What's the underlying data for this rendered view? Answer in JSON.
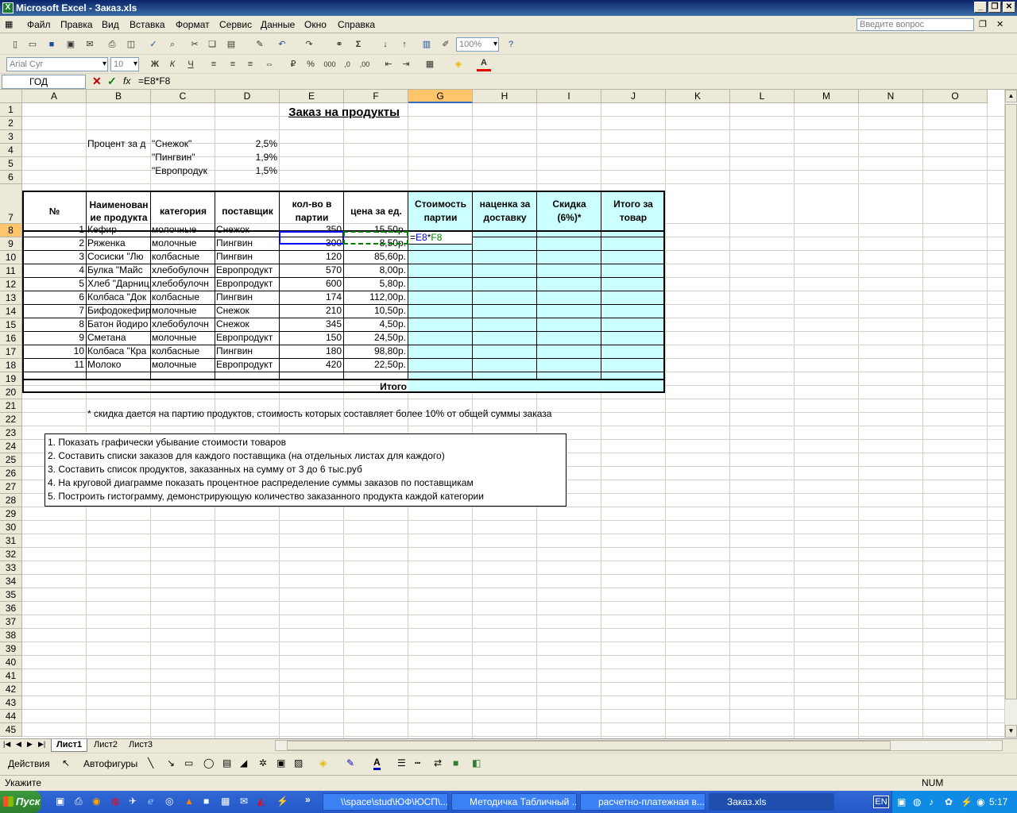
{
  "window": {
    "title": "Microsoft Excel - Заказ.xls"
  },
  "menu": {
    "items": [
      "Файл",
      "Правка",
      "Вид",
      "Вставка",
      "Формат",
      "Сервис",
      "Данные",
      "Окно",
      "Справка"
    ],
    "ask_placeholder": "Введите вопрос"
  },
  "toolbar": {
    "zoom": "100%",
    "font": "Arial Cyr",
    "size": "10"
  },
  "formula": {
    "namebox": "ГОД",
    "content": "=E8*F8"
  },
  "columns": [
    "A",
    "B",
    "C",
    "D",
    "E",
    "F",
    "G",
    "H",
    "I",
    "J",
    "K",
    "L",
    "M",
    "N",
    "O"
  ],
  "rows": [
    "1",
    "2",
    "3",
    "4",
    "5",
    "6",
    "7",
    "8",
    "9",
    "10",
    "11",
    "12",
    "13",
    "14",
    "15",
    "16",
    "17",
    "18",
    "19",
    "20",
    "21",
    "22",
    "23",
    "24",
    "25",
    "26",
    "27",
    "28",
    "29",
    "30",
    "31",
    "32",
    "33",
    "34",
    "35",
    "36",
    "37",
    "38",
    "39",
    "40",
    "41",
    "42",
    "43",
    "44",
    "45"
  ],
  "sheet": {
    "title": "Заказ на продукты",
    "pct_label": "Процент за д",
    "suppliers_pct": [
      {
        "name": "\"Снежок\"",
        "pct": "2,5%"
      },
      {
        "name": "\"Пингвин\"",
        "pct": "1,9%"
      },
      {
        "name": "\"Европродук",
        "pct": "1,5%"
      }
    ],
    "headers": {
      "num": "№",
      "name": "Наименование продукта",
      "cat": "категория",
      "sup": "поставщик",
      "qty": "кол-во в партии",
      "price": "цена за ед.",
      "cost": "Стоимость партии",
      "markup": "наценка за доставку",
      "disc": "Скидка (6%)*",
      "total": "Итого за товар"
    },
    "items": [
      {
        "n": "1",
        "name": "Кефир",
        "cat": "молочные",
        "sup": "Снежок",
        "qty": "350",
        "price": "15,50р."
      },
      {
        "n": "2",
        "name": "Ряженка",
        "cat": "молочные",
        "sup": "Пингвин",
        "qty": "300",
        "price": "8,50р."
      },
      {
        "n": "3",
        "name": "Сосиски \"Лю",
        "cat": "колбасные",
        "sup": "Пингвин",
        "qty": "120",
        "price": "85,60р."
      },
      {
        "n": "4",
        "name": "Булка \"Майс",
        "cat": "хлебобулочн",
        "sup": "Европродукт",
        "qty": "570",
        "price": "8,00р."
      },
      {
        "n": "5",
        "name": "Хлеб \"Дарниц",
        "cat": "хлебобулочн",
        "sup": "Европродукт",
        "qty": "600",
        "price": "5,80р."
      },
      {
        "n": "6",
        "name": "Колбаса \"Док",
        "cat": "колбасные",
        "sup": "Пингвин",
        "qty": "174",
        "price": "112,00р."
      },
      {
        "n": "7",
        "name": "Бифодокефир",
        "cat": "молочные",
        "sup": "Снежок",
        "qty": "210",
        "price": "10,50р."
      },
      {
        "n": "8",
        "name": "Батон йодиро",
        "cat": "хлебобулочн",
        "sup": "Снежок",
        "qty": "345",
        "price": "4,50р."
      },
      {
        "n": "9",
        "name": "Сметана",
        "cat": "молочные",
        "sup": "Европродукт",
        "qty": "150",
        "price": "24,50р."
      },
      {
        "n": "10",
        "name": "Колбаса \"Кра",
        "cat": "колбасные",
        "sup": "Пингвин",
        "qty": "180",
        "price": "98,80р."
      },
      {
        "n": "11",
        "name": "Молоко",
        "cat": "молочные",
        "sup": "Европродукт",
        "qty": "420",
        "price": "22,50р."
      }
    ],
    "edit_cell": "=E8*F8",
    "total_label": "Итого",
    "footnote": "* скидка дается на партию продуктов, стоимость которых составляет более 10% от общей суммы заказа",
    "tasks": [
      "1. Показать графически убывание стоимости товаров",
      "2. Составить списки заказов для каждого поставщика (на отдельных листах для каждого)",
      "3. Составить список продуктов, заказанных на сумму от 3 до 6 тыс.руб",
      "4. На круговой диаграмме показать процентное распределение суммы заказов по поставщикам",
      "5. Построить гистограмму, демонстрирующую количество заказанного продукта каждой категории"
    ]
  },
  "tabs": [
    "Лист1",
    "Лист2",
    "Лист3"
  ],
  "drawbar": {
    "actions": "Действия",
    "autoshapes": "Автофигуры"
  },
  "status": {
    "mode": "Укажите",
    "num": "NUM"
  },
  "taskbar": {
    "start": "Пуск",
    "tasks": [
      "\\\\space\\stud\\ЮФ\\ЮСП\\...",
      "Методичка Табличный ...",
      "расчетно-платежная в...",
      "Заказ.xls"
    ],
    "lang": "EN",
    "clock": "5:17"
  }
}
